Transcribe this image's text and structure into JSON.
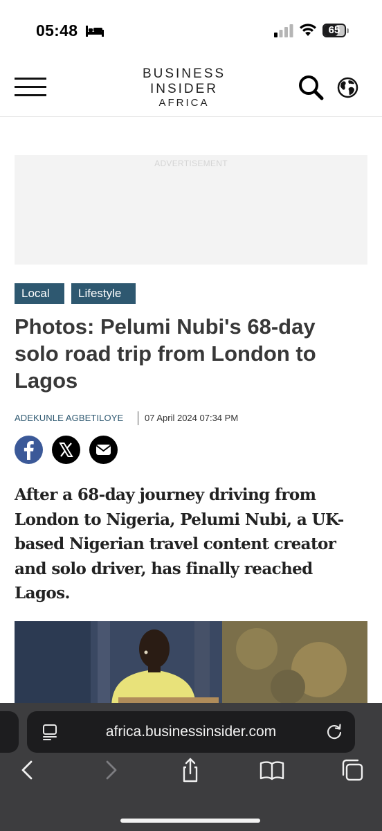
{
  "status_bar": {
    "time": "05:48",
    "battery_level": "65",
    "battery_fraction": 0.65,
    "icons": [
      "bed-icon",
      "signal-icon",
      "wifi-icon",
      "battery-icon"
    ]
  },
  "header": {
    "logo_line1": "BUSINESS",
    "logo_line2": "INSIDER",
    "logo_line3": "AFRICA",
    "icons": [
      "menu-icon",
      "search-icon",
      "globe-icon"
    ]
  },
  "advertisement": {
    "label": "ADVERTISEMENT"
  },
  "article": {
    "tags": [
      "Local",
      "Lifestyle"
    ],
    "headline": "Photos: Pelumi Nubi's 68-day solo road trip from London to Lagos",
    "author": "ADEKUNLE AGBETILOYE",
    "date": "07 April 2024 07:34 PM",
    "share_icons": [
      "facebook-icon",
      "x-icon",
      "email-icon"
    ],
    "lead": "After a 68-day journey driving from London to Nigeria, Pelumi Nubi, a UK-based Nigerian travel content creator and solo driver, has finally reached Lagos."
  },
  "browser": {
    "url": "africa.businessinsider.com",
    "icons": [
      "page-menu-icon",
      "reload-icon",
      "back-icon",
      "forward-icon",
      "share-icon",
      "bookmarks-icon",
      "tabs-icon"
    ]
  },
  "colors": {
    "tag_background": "#2e5870",
    "author_link": "#2e5870",
    "facebook": "#3b5998",
    "browser_bar": "#3d3d3f"
  }
}
